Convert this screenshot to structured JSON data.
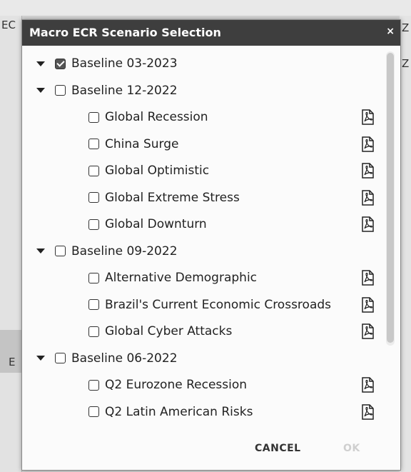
{
  "background": {
    "fragment_left_top": "EC",
    "fragment_left_mid": "E",
    "fragment_right_top": "Z",
    "fragment_right_second": "Z"
  },
  "dialog": {
    "title": "Macro ECR Scenario Selection",
    "close_glyph": "×",
    "cancel_label": "CANCEL",
    "ok_label": "OK"
  },
  "tree": [
    {
      "label": "Baseline 03-2023",
      "level": 0,
      "checked": true,
      "expandable": true,
      "pdf": false
    },
    {
      "label": "Baseline 12-2022",
      "level": 0,
      "checked": false,
      "expandable": true,
      "pdf": false
    },
    {
      "label": "Global Recession",
      "level": 1,
      "checked": false,
      "expandable": false,
      "pdf": true
    },
    {
      "label": "China Surge",
      "level": 1,
      "checked": false,
      "expandable": false,
      "pdf": true
    },
    {
      "label": "Global Optimistic",
      "level": 1,
      "checked": false,
      "expandable": false,
      "pdf": true
    },
    {
      "label": "Global Extreme Stress",
      "level": 1,
      "checked": false,
      "expandable": false,
      "pdf": true
    },
    {
      "label": "Global Downturn",
      "level": 1,
      "checked": false,
      "expandable": false,
      "pdf": true
    },
    {
      "label": "Baseline 09-2022",
      "level": 0,
      "checked": false,
      "expandable": true,
      "pdf": false
    },
    {
      "label": "Alternative Demographic",
      "level": 1,
      "checked": false,
      "expandable": false,
      "pdf": true
    },
    {
      "label": "Brazil's Current Economic Crossroads",
      "level": 1,
      "checked": false,
      "expandable": false,
      "pdf": true
    },
    {
      "label": "Global Cyber Attacks",
      "level": 1,
      "checked": false,
      "expandable": false,
      "pdf": true
    },
    {
      "label": "Baseline 06-2022",
      "level": 0,
      "checked": false,
      "expandable": true,
      "pdf": false
    },
    {
      "label": "Q2 Eurozone Recession",
      "level": 1,
      "checked": false,
      "expandable": false,
      "pdf": true
    },
    {
      "label": "Q2 Latin American Risks",
      "level": 1,
      "checked": false,
      "expandable": false,
      "pdf": true
    }
  ],
  "icons": {
    "expand": "triangle-down-icon",
    "pdf": "pdf-icon",
    "close": "close-icon"
  },
  "colors": {
    "titlebar": "#3e3e3e",
    "dialog_bg": "#fbfbfb",
    "ok_disabled": "#cfcfcf"
  }
}
